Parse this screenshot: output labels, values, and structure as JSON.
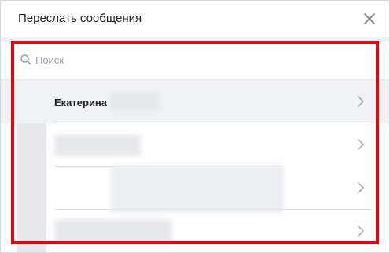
{
  "dialog": {
    "title": "Переслать сообщения"
  },
  "search": {
    "placeholder": "Поиск",
    "value": ""
  },
  "contacts": [
    {
      "name": "Екатерина",
      "blurred": false
    },
    {
      "name": "",
      "blurred": true
    },
    {
      "name": "",
      "blurred": true
    },
    {
      "name": "",
      "blurred": true
    }
  ],
  "icons": {
    "close": "close-icon",
    "search": "search-icon",
    "chevron": "chevron-right-icon"
  },
  "colors": {
    "highlight_frame": "#e3060e",
    "row_hover": "#f0f2f5",
    "separator": "#e1e3e6"
  }
}
